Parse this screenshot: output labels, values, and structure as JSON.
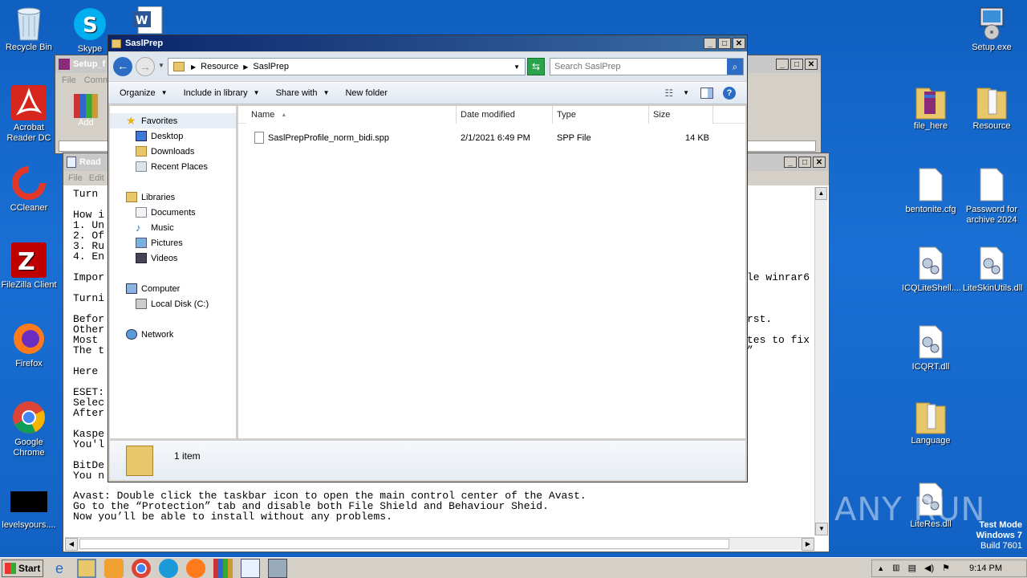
{
  "desktop": {
    "left_icons": [
      {
        "label": "Recycle Bin",
        "icon": "recycle-bin-icon"
      },
      {
        "label": "Acrobat Reader DC",
        "icon": "acrobat-icon"
      },
      {
        "label": "CCleaner",
        "icon": "ccleaner-icon"
      },
      {
        "label": "FileZilla Client",
        "icon": "filezilla-icon"
      },
      {
        "label": "Firefox",
        "icon": "firefox-icon"
      },
      {
        "label": "Google Chrome",
        "icon": "chrome-icon"
      },
      {
        "label": "levelsyours....",
        "icon": "black-file-icon"
      }
    ],
    "top_icons": [
      {
        "label": "Skype",
        "icon": "skype-icon"
      }
    ],
    "right_icons": [
      {
        "label": "Setup.exe",
        "icon": "setup-exe-icon"
      },
      {
        "label": "file_here",
        "icon": "folder-icon"
      },
      {
        "label": "Resource",
        "icon": "folder-icon"
      },
      {
        "label": "bentonite.cfg",
        "icon": "file-icon"
      },
      {
        "label": "Password for archive 2024",
        "icon": "file-icon"
      },
      {
        "label": "ICQLiteShell....",
        "icon": "dll-icon"
      },
      {
        "label": "LiteSkinUtils.dll",
        "icon": "dll-icon"
      },
      {
        "label": "ICQRT.dll",
        "icon": "dll-icon"
      },
      {
        "label": "Language",
        "icon": "folder-icon"
      },
      {
        "label": "LiteRes.dll",
        "icon": "dll-icon"
      }
    ],
    "watermark": "ANY RUN",
    "test_mode": {
      "line1": "Test Mode",
      "line2": "Windows 7",
      "line3": "Build 7601"
    }
  },
  "winrar_window": {
    "title": "Setup_f",
    "menu": [
      "File",
      "Comm"
    ],
    "add_label": "Add"
  },
  "notepad_window": {
    "title": "Read",
    "menu": [
      "File",
      "Edit"
    ],
    "lines_left": [
      "Turn ",
      "",
      "How i",
      "1. Un",
      "2. Of",
      "3. Ru",
      "4. En",
      "",
      "Impor",
      "",
      "Turni",
      "",
      "Befor",
      "Other",
      "Most ",
      "The t",
      "",
      "Here ",
      "",
      "ESET:",
      "Selec",
      "After",
      "",
      "Kaspe",
      "You'l",
      "",
      "BitDe",
      "You n"
    ],
    "lines_right": [
      {
        "row": 8,
        "text": "le winrar6"
      },
      {
        "row": 12,
        "text": "rst."
      },
      {
        "row": 14,
        "text": "tes to fix"
      },
      {
        "row": 15,
        "text": "”"
      }
    ],
    "lines_bottom": [
      "Avast: Double click the taskbar icon to open the main control center of the Avast.",
      "Go to the “Protection” tab and disable both File Shield and Behaviour Sheid.",
      "Now you’ll be able to install without any problems."
    ]
  },
  "explorer": {
    "title": "SaslPrep",
    "breadcrumb": [
      "Resource",
      "SaslPrep"
    ],
    "search_placeholder": "Search SaslPrep",
    "toolbar": {
      "organize": "Organize",
      "include": "Include in library",
      "share": "Share with",
      "new_folder": "New folder"
    },
    "nav": {
      "favorites": "Favorites",
      "fav_items": [
        "Desktop",
        "Downloads",
        "Recent Places"
      ],
      "libraries": "Libraries",
      "lib_items": [
        "Documents",
        "Music",
        "Pictures",
        "Videos"
      ],
      "computer": "Computer",
      "comp_items": [
        "Local Disk (C:)"
      ],
      "network": "Network"
    },
    "columns": [
      "Name",
      "Date modified",
      "Type",
      "Size"
    ],
    "files": [
      {
        "name": "SaslPrepProfile_norm_bidi.spp",
        "date": "2/1/2021 6:49 PM",
        "type": "SPP File",
        "size": "14 KB"
      }
    ],
    "status": "1 item"
  },
  "taskbar": {
    "start": "Start",
    "clock": "9:14 PM"
  }
}
